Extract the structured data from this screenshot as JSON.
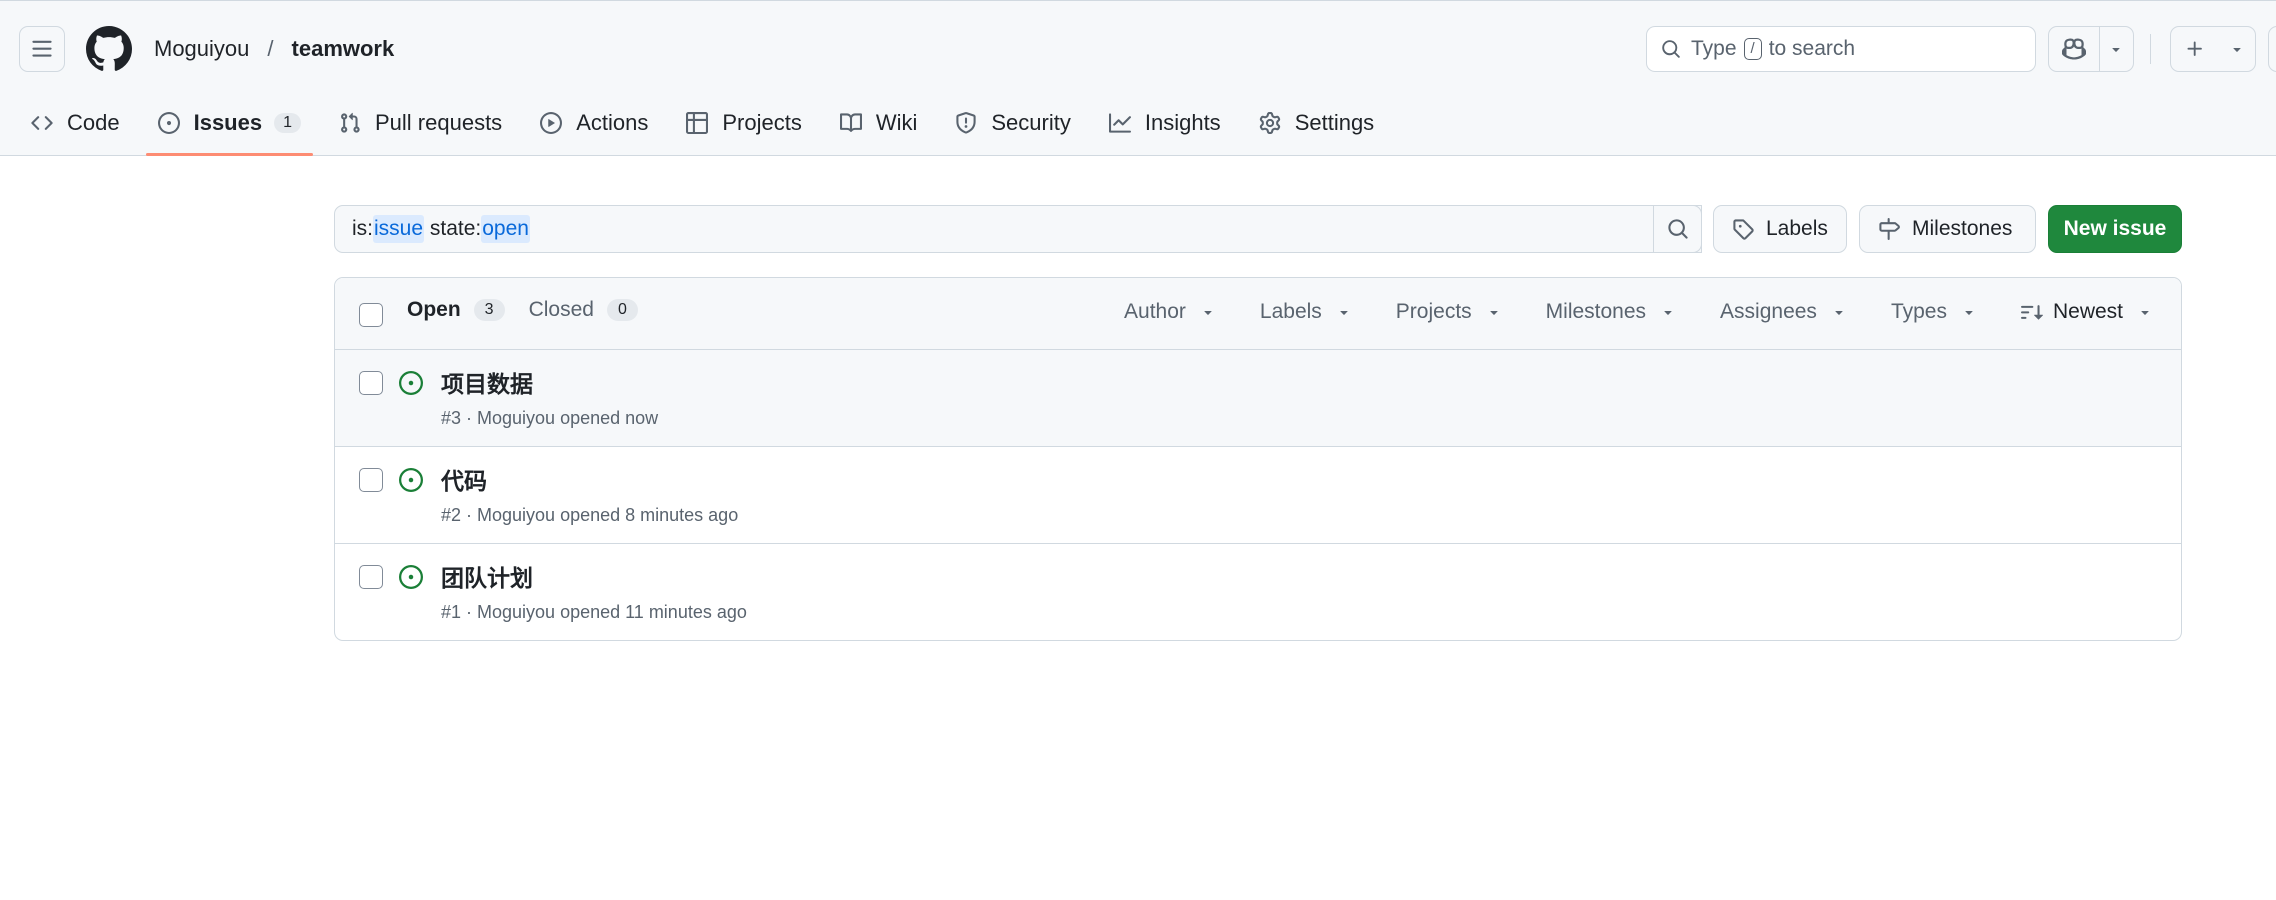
{
  "header": {
    "owner": "Moguiyou",
    "separator": "/",
    "repo": "teamwork",
    "search_prefix": "Type",
    "search_key": "/",
    "search_suffix": "to search"
  },
  "tabs": [
    {
      "label": "Code",
      "icon": "code-icon"
    },
    {
      "label": "Issues",
      "icon": "issue-opened-icon",
      "count": "1",
      "selected": true
    },
    {
      "label": "Pull requests",
      "icon": "git-pull-request-icon"
    },
    {
      "label": "Actions",
      "icon": "play-icon"
    },
    {
      "label": "Projects",
      "icon": "table-icon"
    },
    {
      "label": "Wiki",
      "icon": "book-icon"
    },
    {
      "label": "Security",
      "icon": "shield-icon"
    },
    {
      "label": "Insights",
      "icon": "graph-icon"
    },
    {
      "label": "Settings",
      "icon": "gear-icon"
    }
  ],
  "toolbar": {
    "query_p1": "is:",
    "query_p2": "issue",
    "query_p3": " state:",
    "query_p4": "open",
    "labels_label": "Labels",
    "milestones_label": "Milestones",
    "new_issue_label": "New issue"
  },
  "list": {
    "open_label": "Open",
    "open_count": "3",
    "closed_label": "Closed",
    "closed_count": "0",
    "filters": [
      "Author",
      "Labels",
      "Projects",
      "Milestones",
      "Assignees",
      "Types"
    ],
    "sort_label": "Newest"
  },
  "issues": [
    {
      "title": "项目数据",
      "meta": "#3 · Moguiyou opened now"
    },
    {
      "title": "代码",
      "meta": "#2 · Moguiyou opened 8 minutes ago"
    },
    {
      "title": "团队计划",
      "meta": "#1 · Moguiyou opened 11 minutes ago"
    }
  ],
  "colors": {
    "accent_green": "#1f883d",
    "open_state": "#1a7f37",
    "tab_underline": "#fd8c73",
    "link_blue": "#0969da"
  }
}
